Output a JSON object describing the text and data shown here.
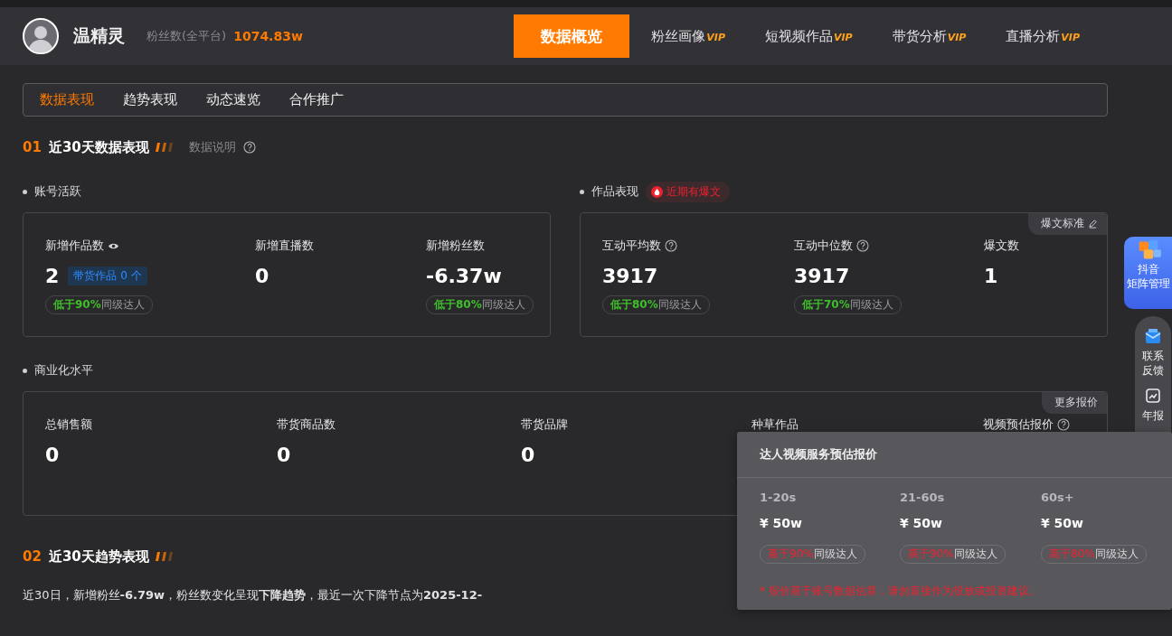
{
  "profile": {
    "name": "温精灵",
    "fans_label": "粉丝数(全平台)",
    "fans_value": "1074.83w"
  },
  "nav_tabs": [
    {
      "label": "数据概览",
      "selected": true
    },
    {
      "label": "粉丝画像",
      "badge": "VIP",
      "selected": false
    },
    {
      "label": "短视频作品",
      "badge": "VIP",
      "selected": false
    },
    {
      "label": "带货分析",
      "badge": "VIP",
      "selected": false
    },
    {
      "label": "直播分析",
      "badge": "VIP",
      "selected": false
    }
  ],
  "sub_tabs": [
    {
      "label": "数据表现",
      "selected": true
    },
    {
      "label": "趋势表现",
      "selected": false
    },
    {
      "label": "动态速览",
      "selected": false
    },
    {
      "label": "合作推广",
      "selected": false
    }
  ],
  "section_1": {
    "number": "01",
    "title": "近30天数据表现",
    "note": "数据说明"
  },
  "account_activity": {
    "title": "账号活跃",
    "metrics": [
      {
        "label": "新增作品数",
        "eye": true,
        "value": "2",
        "tag": "带货作品 0 个",
        "rank": {
          "kind": "lower",
          "compare": "低于90%",
          "label": "同级达人"
        }
      },
      {
        "label": "新增直播数",
        "eye": false,
        "value": "0"
      },
      {
        "label": "新增粉丝数",
        "eye": false,
        "value": "-6.37w",
        "rank": {
          "kind": "lower",
          "compare": "低于80%",
          "label": "同级达人"
        }
      }
    ]
  },
  "work_performance": {
    "title": "作品表现",
    "badge": "近期有爆文",
    "corner": "爆文标准",
    "metrics": [
      {
        "label": "互动平均数",
        "help": true,
        "value": "3917",
        "rank": {
          "kind": "lower",
          "compare": "低于80%",
          "label": "同级达人"
        }
      },
      {
        "label": "互动中位数",
        "help": true,
        "value": "3917",
        "rank": {
          "kind": "lower",
          "compare": "低于70%",
          "label": "同级达人"
        }
      },
      {
        "label": "爆文数",
        "help": false,
        "value": "1"
      }
    ]
  },
  "commerce": {
    "title": "商业化水平",
    "corner": "更多报价",
    "metrics": [
      {
        "label": "总销售额",
        "help": false,
        "value": "0"
      },
      {
        "label": "带货商品数",
        "help": false,
        "value": "0"
      },
      {
        "label": "带货品牌",
        "help": false,
        "value": "0"
      },
      {
        "label": "种草作品",
        "help": false
      },
      {
        "label": "视频预估报价",
        "help": true
      }
    ]
  },
  "section_2": {
    "number": "02",
    "title": "近30天趋势表现",
    "summary": "近30日，新增粉丝**-6.79w**，粉丝数变化呈现**下降趋势**，最近一次下降节点为**2025-12-**"
  },
  "side_float": {
    "matrix": [
      "抖音",
      "矩阵管理"
    ],
    "feedback": "联系反馈",
    "report": "年报"
  },
  "price_popup": {
    "title": "达人视频服务预估报价",
    "columns": [
      {
        "duration": "1-20s",
        "price": "¥ 50w",
        "rank": {
          "kind": "higher",
          "compare": "高于90%",
          "label": "同级达人"
        }
      },
      {
        "duration": "21-60s",
        "price": "¥ 50w",
        "rank": {
          "kind": "higher",
          "compare": "高于90%",
          "label": "同级达人"
        }
      },
      {
        "duration": "60s+",
        "price": "¥ 50w",
        "rank": {
          "kind": "higher",
          "compare": "高于80%",
          "label": "同级达人"
        }
      }
    ],
    "footnote": "* 报价基于账号数据估算，请勿直接作为投放或投资建议。"
  }
}
